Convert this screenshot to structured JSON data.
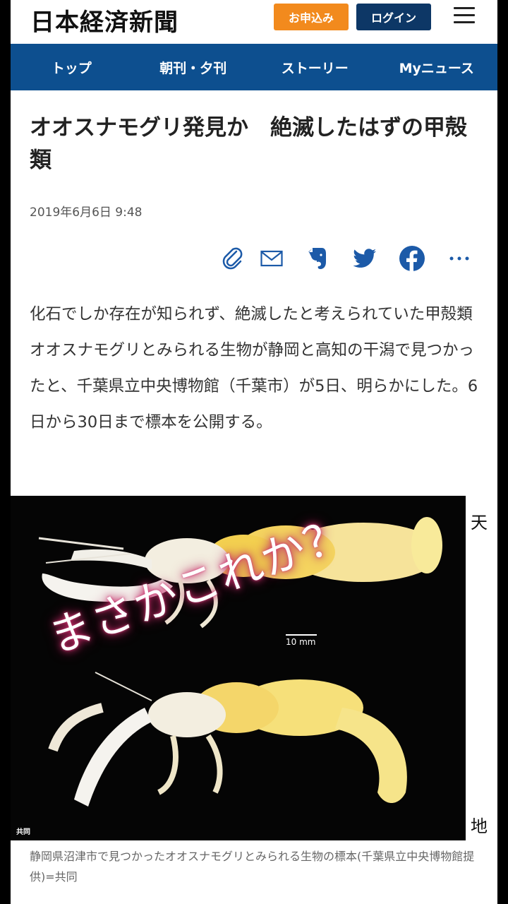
{
  "header": {
    "logo": "日本経済新聞",
    "apply_label": "お申込み",
    "login_label": "ログイン"
  },
  "nav": {
    "items": [
      {
        "label": "トップ"
      },
      {
        "label": "朝刊・夕刊"
      },
      {
        "label": "ストーリー"
      },
      {
        "label": "Myニュース"
      }
    ]
  },
  "article": {
    "title": "オオスナモグリ発見か　絶滅したはずの甲殻類",
    "date": "2019年6月6日 9:48",
    "share_icons": [
      "clip-icon",
      "mail-icon",
      "evernote-icon",
      "twitter-icon",
      "facebook-icon",
      "more-icon"
    ],
    "body": "化石でしか存在が知られず、絶滅したと考えられていた甲殻類オオスナモグリとみられる生物が静岡と高知の干潟で見つかったと、千葉県立中央博物館（千葉市）が5日、明らかにした。6日から30日まで標本を公開する。",
    "photo": {
      "overlay": "まさかこれか？",
      "scale_label": "10 mm",
      "credit": "共同",
      "side_top": "天",
      "side_bottom": "地"
    },
    "caption": "静岡県沼津市で見つかったオオスナモグリとみられる生物の標本(千葉県立中央博物館提供)=共同"
  },
  "colors": {
    "nav_bg": "#0d4f8f",
    "apply_bg": "#f28a1d",
    "login_bg": "#0d3766",
    "share_blue": "#1c5aa8"
  }
}
